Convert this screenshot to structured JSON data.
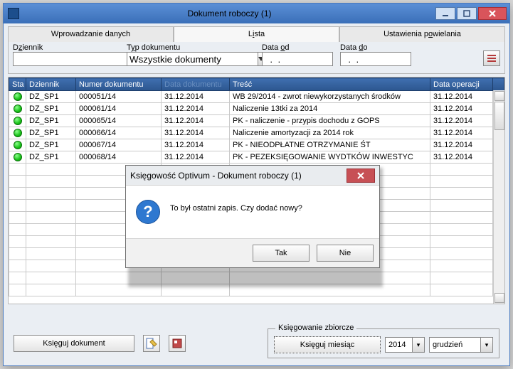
{
  "window": {
    "title": "Dokument roboczy (1)"
  },
  "tabs": {
    "entry": "Wprowadzanie danych",
    "list_pre": "L",
    "list_accel": "i",
    "list_post": "sta",
    "dup_pre": "Ustawienia p",
    "dup_accel": "o",
    "dup_post": "wielania"
  },
  "filters": {
    "dziennik_pre": "D",
    "dziennik_accel": "z",
    "dziennik_post": "iennik",
    "typ_pre": "T",
    "typ_accel": "y",
    "typ_post": "p dokumentu",
    "typ_value": "Wszystkie dokumenty",
    "dataod_pre": "Data ",
    "dataod_accel": "o",
    "dataod_post": "d",
    "dataod_value": "  .  .",
    "datado_pre": "Data ",
    "datado_accel": "d",
    "datado_post": "o",
    "datado_value": "  .  ."
  },
  "columns": {
    "sta": "Sta",
    "dziennik": "Dziennik",
    "numer": "Numer dokumentu",
    "data_dok": "Data dokumentu",
    "tresc": "Treść",
    "data_op": "Data operacji"
  },
  "rows": [
    {
      "dz": "DZ_SP1",
      "nr": "000051/14",
      "dd": "31.12.2014",
      "tr": "WB 29/2014 - zwrot niewykorzystanych środków",
      "do": "31.12.2014"
    },
    {
      "dz": "DZ_SP1",
      "nr": "000061/14",
      "dd": "31.12.2014",
      "tr": "Naliczenie 13tki za 2014",
      "do": "31.12.2014"
    },
    {
      "dz": "DZ_SP1",
      "nr": "000065/14",
      "dd": "31.12.2014",
      "tr": "PK - naliczenie - przypis dochodu z GOPS",
      "do": "31.12.2014"
    },
    {
      "dz": "DZ_SP1",
      "nr": "000066/14",
      "dd": "31.12.2014",
      "tr": "Naliczenie amortyzacji za 2014 rok",
      "do": "31.12.2014"
    },
    {
      "dz": "DZ_SP1",
      "nr": "000067/14",
      "dd": "31.12.2014",
      "tr": "PK - NIEODPŁATNE OTRZYMANIE ŚT",
      "do": "31.12.2014"
    },
    {
      "dz": "DZ_SP1",
      "nr": "000068/14",
      "dd": "31.12.2014",
      "tr": "PK - PEZEKSIĘGOWANIE WYDTKÓW INWESTYC",
      "do": "31.12.2014"
    }
  ],
  "bottom": {
    "ksieguj_pre": "K",
    "ksieguj_accel": "s",
    "ksieguj_post": "ięguj dokument",
    "group_pre": "Księgowanie ",
    "group_accel": "z",
    "group_post": "biorcze",
    "ksieguj_m_pre": "Księgu",
    "ksieguj_m_accel": "j",
    "ksieguj_m_post": " miesiąc",
    "year": "2014",
    "month": "grudzień"
  },
  "modal": {
    "title": "Księgowość Optivum - Dokument roboczy (1)",
    "message": "To był ostatni zapis. Czy dodać nowy?",
    "yes": "Tak",
    "no": "Nie"
  }
}
